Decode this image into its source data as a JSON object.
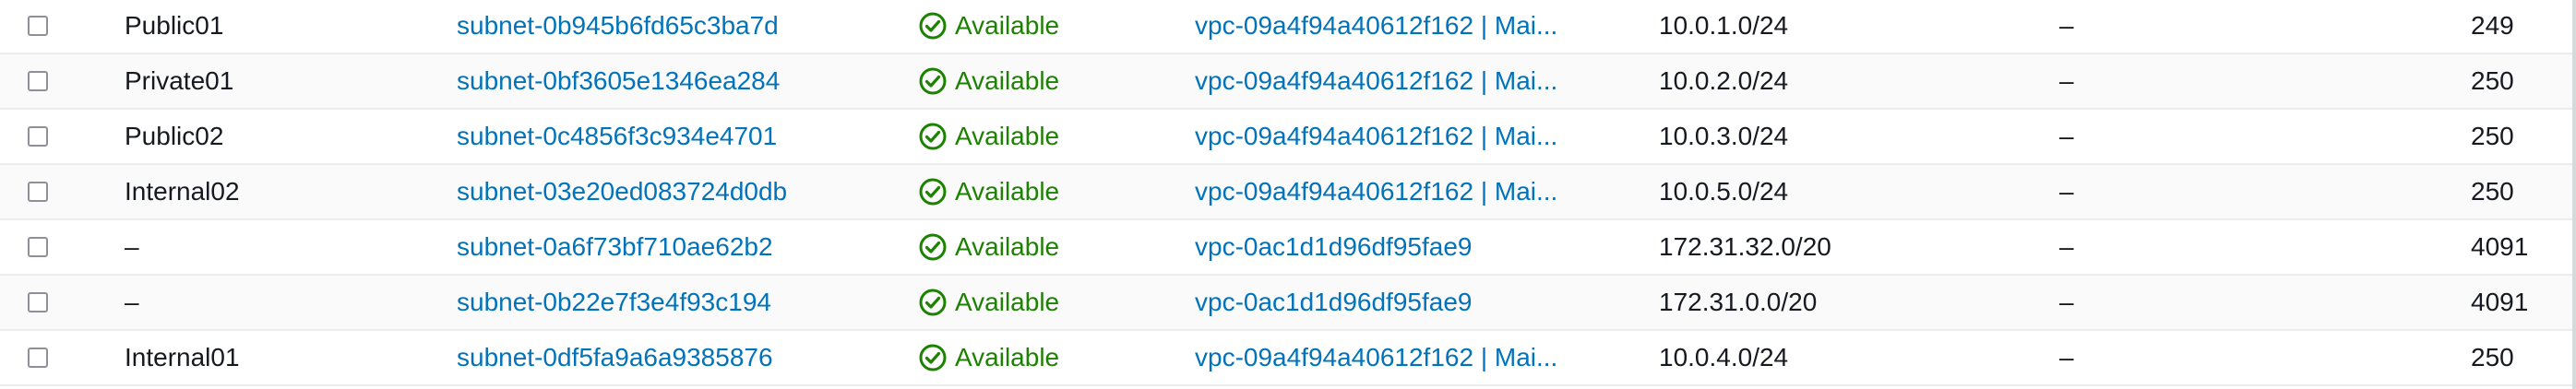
{
  "colors": {
    "link": "#0073bb",
    "status_available": "#1d8102",
    "text": "#16191f",
    "row_border": "#eaeded"
  },
  "status_icon": "check-circle-icon",
  "rows": [
    {
      "name": "Public01",
      "subnet_id": "subnet-0b945b6fd65c3ba7d",
      "state": "Available",
      "vpc": "vpc-09a4f94a40612f162 | Mai...",
      "cidr": "10.0.1.0/24",
      "ipv6_cidr": "–",
      "available_ips": "249"
    },
    {
      "name": "Private01",
      "subnet_id": "subnet-0bf3605e1346ea284",
      "state": "Available",
      "vpc": "vpc-09a4f94a40612f162 | Mai...",
      "cidr": "10.0.2.0/24",
      "ipv6_cidr": "–",
      "available_ips": "250"
    },
    {
      "name": "Public02",
      "subnet_id": "subnet-0c4856f3c934e4701",
      "state": "Available",
      "vpc": "vpc-09a4f94a40612f162 | Mai...",
      "cidr": "10.0.3.0/24",
      "ipv6_cidr": "–",
      "available_ips": "250"
    },
    {
      "name": "Internal02",
      "subnet_id": "subnet-03e20ed083724d0db",
      "state": "Available",
      "vpc": "vpc-09a4f94a40612f162 | Mai...",
      "cidr": "10.0.5.0/24",
      "ipv6_cidr": "–",
      "available_ips": "250"
    },
    {
      "name": "–",
      "subnet_id": "subnet-0a6f73bf710ae62b2",
      "state": "Available",
      "vpc": "vpc-0ac1d1d96df95fae9",
      "cidr": "172.31.32.0/20",
      "ipv6_cidr": "–",
      "available_ips": "4091"
    },
    {
      "name": "–",
      "subnet_id": "subnet-0b22e7f3e4f93c194",
      "state": "Available",
      "vpc": "vpc-0ac1d1d96df95fae9",
      "cidr": "172.31.0.0/20",
      "ipv6_cidr": "–",
      "available_ips": "4091"
    },
    {
      "name": "Internal01",
      "subnet_id": "subnet-0df5fa9a6a9385876",
      "state": "Available",
      "vpc": "vpc-09a4f94a40612f162 | Mai...",
      "cidr": "10.0.4.0/24",
      "ipv6_cidr": "–",
      "available_ips": "250"
    }
  ]
}
